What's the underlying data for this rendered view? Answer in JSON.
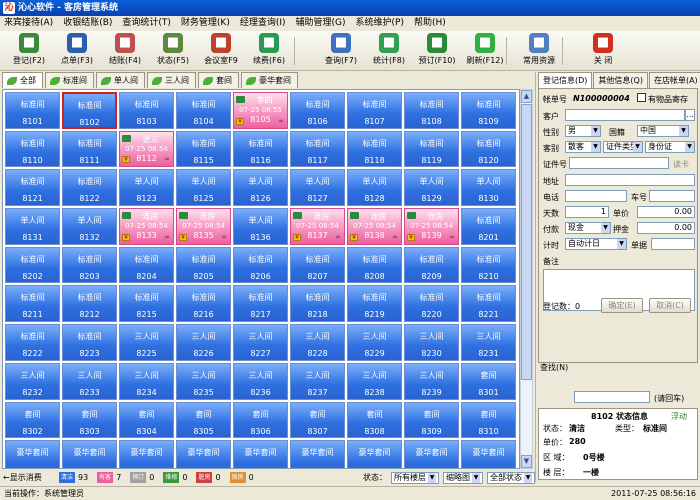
{
  "window": {
    "title": "沁心软件 - 客房管理系统"
  },
  "menu": [
    "来宾接待(A)",
    "收银结账(B)",
    "查询统计(T)",
    "财务管理(K)",
    "经理查询(I)",
    "辅助管理(G)",
    "系统维护(P)",
    "帮助(H)"
  ],
  "toolbar": [
    {
      "label": "登记(F2)",
      "icon": "register-icon",
      "color": "#3a8a3a"
    },
    {
      "label": "点单(F3)",
      "icon": "order-icon",
      "color": "#2a5fb0"
    },
    {
      "label": "结账(F4)",
      "icon": "checkout-icon",
      "color": "#c05050"
    },
    {
      "label": "状态(F5)",
      "icon": "status-icon",
      "color": "#5a8a40"
    },
    {
      "label": "会议室F9",
      "icon": "meeting-room-icon",
      "color": "#c04030"
    },
    {
      "label": "续费(F6)",
      "icon": "renew-icon",
      "color": "#2a9a50"
    },
    {
      "label": "查询(F7)",
      "icon": "search-icon",
      "color": "#4070c0"
    },
    {
      "label": "统计(F8)",
      "icon": "statistics-icon",
      "color": "#30a050"
    },
    {
      "label": "预订(F10)",
      "icon": "reserve-icon",
      "color": "#2a8a3a"
    },
    {
      "label": "刷新(F12)",
      "icon": "refresh-icon",
      "color": "#30b040"
    },
    {
      "label": "常用资源",
      "icon": "resources-icon",
      "color": "#5080c0"
    },
    {
      "label": "关  闭",
      "icon": "close-icon",
      "color": "#d03020"
    }
  ],
  "tabs": [
    "全部",
    "标准间",
    "单人间",
    "三人间",
    "套间",
    "豪华套间"
  ],
  "rooms": [
    {
      "type": "标准间",
      "no": "8101"
    },
    {
      "type": "标准间",
      "no": "8102",
      "selected": true
    },
    {
      "type": "标准间",
      "no": "8103"
    },
    {
      "type": "标准间",
      "no": "8104"
    },
    {
      "type": "李四",
      "no": "8105",
      "occupied": true,
      "time": "07-25 08:55"
    },
    {
      "type": "标准间",
      "no": "8106"
    },
    {
      "type": "标准间",
      "no": "8107"
    },
    {
      "type": "标准间",
      "no": "8108"
    },
    {
      "type": "标准间",
      "no": "8109"
    },
    {
      "type": "标准间",
      "no": "8110"
    },
    {
      "type": "标准间",
      "no": "8111"
    },
    {
      "type": "张三",
      "no": "8112",
      "occupied": true,
      "time": "07-25 08:54"
    },
    {
      "type": "标准间",
      "no": "8115"
    },
    {
      "type": "标准间",
      "no": "8116"
    },
    {
      "type": "标准间",
      "no": "8117"
    },
    {
      "type": "标准间",
      "no": "8118"
    },
    {
      "type": "标准间",
      "no": "8119"
    },
    {
      "type": "标准间",
      "no": "8120"
    },
    {
      "type": "标准间",
      "no": "8121"
    },
    {
      "type": "标准间",
      "no": "8122"
    },
    {
      "type": "单人间",
      "no": "8123"
    },
    {
      "type": "单人间",
      "no": "8125"
    },
    {
      "type": "单人间",
      "no": "8126"
    },
    {
      "type": "单人间",
      "no": "8127"
    },
    {
      "type": "单人间",
      "no": "8128"
    },
    {
      "type": "单人间",
      "no": "8129"
    },
    {
      "type": "单人间",
      "no": "8130"
    },
    {
      "type": "单人间",
      "no": "8131"
    },
    {
      "type": "单人间",
      "no": "8132"
    },
    {
      "type": "连房",
      "no": "8133",
      "occupied": true,
      "time": "07-25 08:54"
    },
    {
      "type": "连房",
      "no": "8135",
      "occupied": true,
      "time": "07-25 08:54"
    },
    {
      "type": "单人间",
      "no": "8136"
    },
    {
      "type": "连房",
      "no": "8137",
      "occupied": true,
      "time": "07-25 08:54"
    },
    {
      "type": "连房",
      "no": "8138",
      "occupied": true,
      "time": "07-25 08:54"
    },
    {
      "type": "连房",
      "no": "8139",
      "occupied": true,
      "time": "07-25 08:54"
    },
    {
      "type": "标准间",
      "no": "8201"
    },
    {
      "type": "标准间",
      "no": "8202"
    },
    {
      "type": "标准间",
      "no": "8203"
    },
    {
      "type": "标准间",
      "no": "8204"
    },
    {
      "type": "标准间",
      "no": "8205"
    },
    {
      "type": "标准间",
      "no": "8206"
    },
    {
      "type": "标准间",
      "no": "8207"
    },
    {
      "type": "标准间",
      "no": "8208"
    },
    {
      "type": "标准间",
      "no": "8209"
    },
    {
      "type": "标准间",
      "no": "8210"
    },
    {
      "type": "标准间",
      "no": "8211"
    },
    {
      "type": "标准间",
      "no": "8212"
    },
    {
      "type": "标准间",
      "no": "8215"
    },
    {
      "type": "标准间",
      "no": "8216"
    },
    {
      "type": "标准间",
      "no": "8217"
    },
    {
      "type": "标准间",
      "no": "8218"
    },
    {
      "type": "标准间",
      "no": "8219"
    },
    {
      "type": "标准间",
      "no": "8220"
    },
    {
      "type": "标准间",
      "no": "8221"
    },
    {
      "type": "标准间",
      "no": "8222"
    },
    {
      "type": "标准间",
      "no": "8223"
    },
    {
      "type": "三人间",
      "no": "8225"
    },
    {
      "type": "三人间",
      "no": "8226"
    },
    {
      "type": "三人间",
      "no": "8227"
    },
    {
      "type": "三人间",
      "no": "8228"
    },
    {
      "type": "三人间",
      "no": "8229"
    },
    {
      "type": "三人间",
      "no": "8230"
    },
    {
      "type": "三人间",
      "no": "8231"
    },
    {
      "type": "三人间",
      "no": "8232"
    },
    {
      "type": "三人间",
      "no": "8233"
    },
    {
      "type": "三人间",
      "no": "8234"
    },
    {
      "type": "三人间",
      "no": "8235"
    },
    {
      "type": "三人间",
      "no": "8236"
    },
    {
      "type": "三人间",
      "no": "8237"
    },
    {
      "type": "三人间",
      "no": "8238"
    },
    {
      "type": "三人间",
      "no": "8239"
    },
    {
      "type": "套间",
      "no": "8301"
    },
    {
      "type": "套间",
      "no": "8302"
    },
    {
      "type": "套间",
      "no": "8303"
    },
    {
      "type": "套间",
      "no": "8304"
    },
    {
      "type": "套间",
      "no": "8305"
    },
    {
      "type": "套间",
      "no": "8306"
    },
    {
      "type": "套间",
      "no": "8307"
    },
    {
      "type": "套间",
      "no": "8308"
    },
    {
      "type": "套间",
      "no": "8309"
    },
    {
      "type": "套间",
      "no": "8310"
    },
    {
      "type": "豪华套间",
      "no": ""
    },
    {
      "type": "豪华套间",
      "no": ""
    },
    {
      "type": "豪华套间",
      "no": ""
    },
    {
      "type": "豪华套间",
      "no": ""
    },
    {
      "type": "豪华套间",
      "no": ""
    },
    {
      "type": "豪华套间",
      "no": ""
    },
    {
      "type": "豪华套间",
      "no": ""
    },
    {
      "type": "豪华套间",
      "no": ""
    },
    {
      "type": "豪华套间",
      "no": ""
    }
  ],
  "bottom": {
    "show_consume": "←显示消费",
    "legend": [
      {
        "label": "清洁",
        "count": "93",
        "color": "#2e6fe0"
      },
      {
        "label": "有客",
        "count": "7",
        "color": "#ee5fa0"
      },
      {
        "label": "预订",
        "count": "0",
        "color": "#a0a0a0"
      },
      {
        "label": "维修",
        "count": "0",
        "color": "#3a9a3a"
      },
      {
        "label": "脏房",
        "count": "0",
        "color": "#d04040"
      },
      {
        "label": "锁房",
        "count": "0",
        "color": "#e09030"
      }
    ],
    "status_label": "状态：",
    "floor_select": "所有楼层",
    "view_select": "缩略图",
    "state_select": "全部状态"
  },
  "statusbar": {
    "left": "当前操作：系统管理员",
    "right": "2011-07-25 08:56:16"
  },
  "right": {
    "tabs": [
      "登记信息(D)",
      "其他信息(Q)",
      "在店帐单(A)"
    ],
    "form": {
      "account_label": "帐单号",
      "account_value": "N100000004",
      "deposit_label": "有物品寄存",
      "customer_label": "客户",
      "gender_label": "性别",
      "gender_value": "男",
      "nationality_label": "国籍",
      "nationality_value": "中国",
      "guest_type_label": "客别",
      "guest_type_value": "散客",
      "id_type_label": "证件类型",
      "id_type_value": "身份证",
      "id_no_label": "证件号",
      "read_card": "读卡",
      "address_label": "地址",
      "phone_label": "电话",
      "car_label": "车号",
      "days_label": "天数",
      "days_value": "1",
      "unit_price_label": "单价",
      "unit_price_value": "0.00",
      "payment_label": "付款",
      "payment_value": "现金",
      "deposit_amt_label": "押金",
      "deposit_amt_value": "0.00",
      "billing_label": "计时",
      "billing_value": "自动计日",
      "bill_label": "单据",
      "remark_label": "备注",
      "count_label": "登记数：0",
      "confirm": "确定(E)",
      "cancel": "取消(C)"
    },
    "search_label": "查找(N)",
    "search_button": "(请回车)",
    "info": {
      "title": "8102 状态信息",
      "float": "浮动",
      "state_label": "状态：",
      "state_value": "清洁",
      "type_label": "类型：",
      "type_value": "标准间",
      "price_label": "单价：",
      "price_value": "280",
      "area_label": "区   域：",
      "area_value": "0号楼",
      "floor_label": "楼   层：",
      "floor_value": "一楼"
    }
  }
}
